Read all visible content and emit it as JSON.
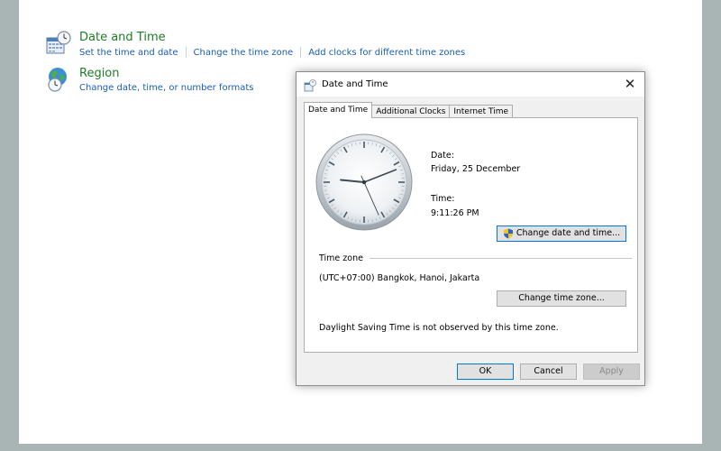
{
  "control_panel": {
    "date_time": {
      "title": "Date and Time",
      "icon": "calendar-clock-icon",
      "links": [
        "Set the time and date",
        "Change the time zone",
        "Add clocks for different time zones"
      ]
    },
    "region": {
      "title": "Region",
      "icon": "globe-clock-icon",
      "links": [
        "Change date, time, or number formats"
      ]
    }
  },
  "dialog": {
    "title": "Date and Time",
    "close_glyph": "✕",
    "tabs": [
      "Date and Time",
      "Additional Clocks",
      "Internet Time"
    ],
    "active_tab": "Date and Time",
    "date_label": "Date:",
    "date_value": "Friday, 25 December",
    "time_label": "Time:",
    "time_value": "9:11:26 PM",
    "change_datetime_button": "Change date and time...",
    "time_zone_heading": "Time zone",
    "time_zone_value": "(UTC+07:00) Bangkok, Hanoi, Jakarta",
    "change_timezone_button": "Change time zone...",
    "dst_note": "Daylight Saving Time is not observed by this time zone.",
    "ok_button": "OK",
    "cancel_button": "Cancel",
    "apply_button": "Apply",
    "apply_enabled": false
  },
  "clock": {
    "hours": 9,
    "minutes": 11,
    "seconds": 26
  },
  "colors": {
    "link": "#1a5eb0",
    "category_title": "#1e7d27",
    "desktop": "#a9b4b4",
    "default_button_border": "#0078d7"
  }
}
